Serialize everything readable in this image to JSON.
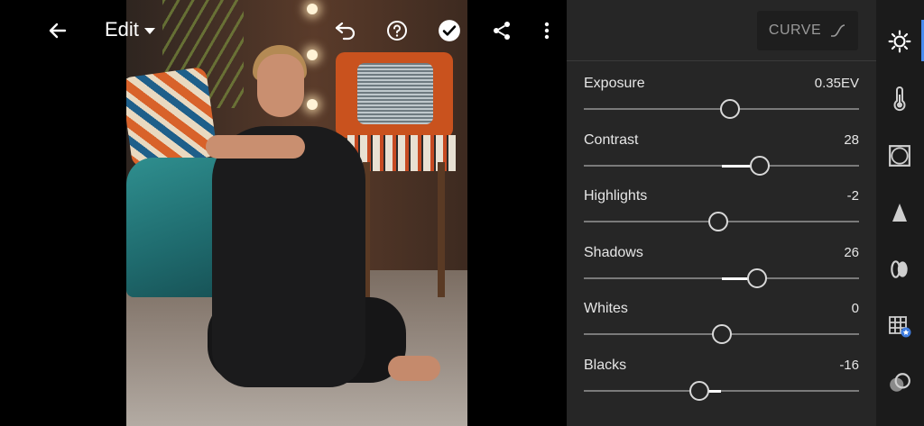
{
  "toolbar": {
    "title": "Edit"
  },
  "panel": {
    "curve_label": "CURVE",
    "sliders": [
      {
        "name": "Exposure",
        "value": "0.35EV",
        "position": 0.53
      },
      {
        "name": "Contrast",
        "value": "28",
        "position": 0.64
      },
      {
        "name": "Highlights",
        "value": "-2",
        "position": 0.49
      },
      {
        "name": "Shadows",
        "value": "26",
        "position": 0.63
      },
      {
        "name": "Whites",
        "value": "0",
        "position": 0.5
      },
      {
        "name": "Blacks",
        "value": "-16",
        "position": 0.42
      }
    ]
  },
  "rail": {
    "tools": [
      "light-icon",
      "color-icon",
      "effects-icon",
      "detail-icon",
      "optics-icon",
      "geometry-icon",
      "presets-icon"
    ]
  },
  "colors": {
    "panel_bg": "#262626",
    "rail_bg": "#1b1b1b",
    "accent": "#4a8cf0"
  }
}
